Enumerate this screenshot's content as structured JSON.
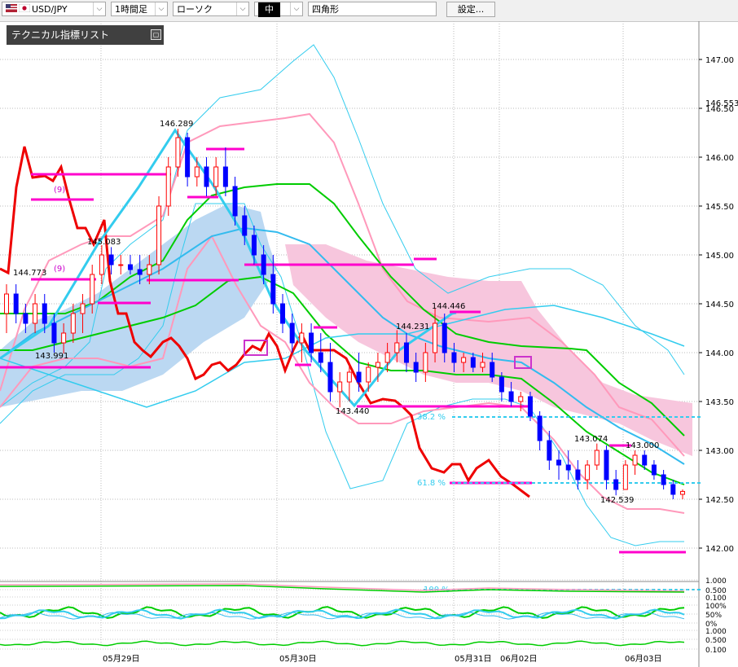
{
  "toolbar": {
    "symbol": "USD/JPY",
    "timeframe": "1時間足",
    "chart_style": "ローソク",
    "line_width": "中",
    "drawing_tool": "四角形",
    "settings_label": "設定..."
  },
  "panel": {
    "title": "テクニカル指標リスト"
  },
  "colors": {
    "up_candle": "#ff0000",
    "down_candle": "#0000ff",
    "bollinger_outer": "#33ccee",
    "bollinger_inner": "#ff99bb",
    "ma_short": "#00cc00",
    "ma_long": "#33bbee",
    "chikou": "#ee0000",
    "ichimoku_cloud_bull": "#bbd8f2",
    "ichimoku_cloud_bear": "#f7c6dd",
    "level_lines": "#ff00cc",
    "fib_lines": "#33ccee"
  },
  "chart_data": {
    "type": "candlestick",
    "y_ticks": [
      "147.00",
      "146.50",
      "146.00",
      "145.50",
      "145.00",
      "144.50",
      "144.00",
      "143.50",
      "143.00",
      "142.50",
      "142.00"
    ],
    "current_price_label": "146.553",
    "date_labels": [
      "05月29日",
      "05月30日",
      "05月31日",
      "06月02日",
      "06月03日"
    ],
    "price_annotations": [
      "146.289",
      "145.083",
      "144.773",
      "143.991",
      "144.446",
      "144.231",
      "143.440",
      "143.074",
      "143.000",
      "142.539"
    ],
    "period_labels": [
      "(9)",
      "(9)"
    ],
    "fib_labels": [
      "38.2 %",
      "61.8 %",
      "100 %"
    ],
    "oscillator_1_ticks": [
      "1.000",
      "0.500",
      "0.100"
    ],
    "oscillator_2_ticks": [
      "100%",
      "50%",
      "0%"
    ],
    "oscillator_3_ticks": [
      "1.000",
      "0.500",
      "0.100"
    ],
    "candles": [
      {
        "o": 144.4,
        "h": 144.7,
        "l": 144.2,
        "c": 144.6
      },
      {
        "o": 144.6,
        "h": 144.7,
        "l": 144.3,
        "c": 144.4
      },
      {
        "o": 144.4,
        "h": 144.5,
        "l": 144.2,
        "c": 144.3
      },
      {
        "o": 144.3,
        "h": 144.6,
        "l": 144.2,
        "c": 144.5
      },
      {
        "o": 144.5,
        "h": 144.6,
        "l": 144.2,
        "c": 144.3
      },
      {
        "o": 144.3,
        "h": 144.4,
        "l": 144.0,
        "c": 144.1
      },
      {
        "o": 144.1,
        "h": 144.3,
        "l": 143.99,
        "c": 144.2
      },
      {
        "o": 144.2,
        "h": 144.5,
        "l": 144.1,
        "c": 144.4
      },
      {
        "o": 144.4,
        "h": 144.6,
        "l": 144.2,
        "c": 144.5
      },
      {
        "o": 144.5,
        "h": 144.9,
        "l": 144.4,
        "c": 144.8
      },
      {
        "o": 144.8,
        "h": 145.1,
        "l": 144.7,
        "c": 145.0
      },
      {
        "o": 145.0,
        "h": 145.08,
        "l": 144.8,
        "c": 144.9
      },
      {
        "o": 144.9,
        "h": 145.0,
        "l": 144.8,
        "c": 144.9
      },
      {
        "o": 144.9,
        "h": 145.0,
        "l": 144.8,
        "c": 144.85
      },
      {
        "o": 144.85,
        "h": 145.0,
        "l": 144.7,
        "c": 144.8
      },
      {
        "o": 144.8,
        "h": 145.0,
        "l": 144.7,
        "c": 144.9
      },
      {
        "o": 144.9,
        "h": 145.6,
        "l": 144.8,
        "c": 145.5
      },
      {
        "o": 145.5,
        "h": 146.0,
        "l": 145.4,
        "c": 145.9
      },
      {
        "o": 145.9,
        "h": 146.29,
        "l": 145.8,
        "c": 146.2
      },
      {
        "o": 146.2,
        "h": 146.25,
        "l": 145.7,
        "c": 145.8
      },
      {
        "o": 145.8,
        "h": 146.0,
        "l": 145.7,
        "c": 145.9
      },
      {
        "o": 145.9,
        "h": 146.0,
        "l": 145.6,
        "c": 145.7
      },
      {
        "o": 145.7,
        "h": 146.0,
        "l": 145.6,
        "c": 145.9
      },
      {
        "o": 145.9,
        "h": 146.1,
        "l": 145.6,
        "c": 145.7
      },
      {
        "o": 145.7,
        "h": 145.8,
        "l": 145.3,
        "c": 145.4
      },
      {
        "o": 145.4,
        "h": 145.5,
        "l": 145.1,
        "c": 145.2
      },
      {
        "o": 145.2,
        "h": 145.3,
        "l": 144.9,
        "c": 145.0
      },
      {
        "o": 145.0,
        "h": 145.1,
        "l": 144.7,
        "c": 144.8
      },
      {
        "o": 144.8,
        "h": 145.0,
        "l": 144.4,
        "c": 144.5
      },
      {
        "o": 144.5,
        "h": 144.6,
        "l": 144.2,
        "c": 144.3
      },
      {
        "o": 144.3,
        "h": 144.4,
        "l": 144.0,
        "c": 144.1
      },
      {
        "o": 144.1,
        "h": 144.3,
        "l": 143.9,
        "c": 144.2
      },
      {
        "o": 144.2,
        "h": 144.3,
        "l": 143.9,
        "c": 144.0
      },
      {
        "o": 144.0,
        "h": 144.2,
        "l": 143.8,
        "c": 143.9
      },
      {
        "o": 143.9,
        "h": 144.1,
        "l": 143.5,
        "c": 143.6
      },
      {
        "o": 143.6,
        "h": 143.8,
        "l": 143.44,
        "c": 143.7
      },
      {
        "o": 143.7,
        "h": 143.9,
        "l": 143.5,
        "c": 143.8
      },
      {
        "o": 143.8,
        "h": 144.0,
        "l": 143.6,
        "c": 143.7
      },
      {
        "o": 143.7,
        "h": 143.9,
        "l": 143.6,
        "c": 143.85
      },
      {
        "o": 143.85,
        "h": 144.0,
        "l": 143.7,
        "c": 143.9
      },
      {
        "o": 143.9,
        "h": 144.1,
        "l": 143.8,
        "c": 144.0
      },
      {
        "o": 144.0,
        "h": 144.23,
        "l": 143.9,
        "c": 144.1
      },
      {
        "o": 144.1,
        "h": 144.2,
        "l": 143.8,
        "c": 143.9
      },
      {
        "o": 143.9,
        "h": 144.0,
        "l": 143.7,
        "c": 143.8
      },
      {
        "o": 143.8,
        "h": 144.1,
        "l": 143.7,
        "c": 144.0
      },
      {
        "o": 144.0,
        "h": 144.45,
        "l": 143.9,
        "c": 144.3
      },
      {
        "o": 144.3,
        "h": 144.4,
        "l": 143.9,
        "c": 144.0
      },
      {
        "o": 144.0,
        "h": 144.1,
        "l": 143.8,
        "c": 143.9
      },
      {
        "o": 143.9,
        "h": 144.0,
        "l": 143.8,
        "c": 143.95
      },
      {
        "o": 143.95,
        "h": 144.0,
        "l": 143.8,
        "c": 143.85
      },
      {
        "o": 143.85,
        "h": 144.0,
        "l": 143.8,
        "c": 143.9
      },
      {
        "o": 143.9,
        "h": 144.0,
        "l": 143.7,
        "c": 143.75
      },
      {
        "o": 143.75,
        "h": 143.8,
        "l": 143.5,
        "c": 143.6
      },
      {
        "o": 143.6,
        "h": 143.7,
        "l": 143.45,
        "c": 143.5
      },
      {
        "o": 143.5,
        "h": 143.6,
        "l": 143.4,
        "c": 143.55
      },
      {
        "o": 143.55,
        "h": 143.6,
        "l": 143.3,
        "c": 143.35
      },
      {
        "o": 143.35,
        "h": 143.4,
        "l": 143.0,
        "c": 143.1
      },
      {
        "o": 143.1,
        "h": 143.2,
        "l": 142.8,
        "c": 142.9
      },
      {
        "o": 142.9,
        "h": 143.0,
        "l": 142.7,
        "c": 142.85
      },
      {
        "o": 142.85,
        "h": 143.0,
        "l": 142.7,
        "c": 142.8
      },
      {
        "o": 142.8,
        "h": 142.9,
        "l": 142.6,
        "c": 142.7
      },
      {
        "o": 142.7,
        "h": 142.9,
        "l": 142.6,
        "c": 142.85
      },
      {
        "o": 142.85,
        "h": 143.07,
        "l": 142.8,
        "c": 143.0
      },
      {
        "o": 143.0,
        "h": 143.05,
        "l": 142.6,
        "c": 142.7
      },
      {
        "o": 142.7,
        "h": 142.8,
        "l": 142.54,
        "c": 142.6
      },
      {
        "o": 142.6,
        "h": 142.9,
        "l": 142.6,
        "c": 142.85
      },
      {
        "o": 142.85,
        "h": 143.0,
        "l": 142.75,
        "c": 142.95
      },
      {
        "o": 142.95,
        "h": 143.0,
        "l": 142.8,
        "c": 142.85
      },
      {
        "o": 142.85,
        "h": 142.9,
        "l": 142.7,
        "c": 142.75
      },
      {
        "o": 142.75,
        "h": 142.8,
        "l": 142.6,
        "c": 142.65
      },
      {
        "o": 142.65,
        "h": 142.7,
        "l": 142.5,
        "c": 142.55
      },
      {
        "o": 142.55,
        "h": 142.6,
        "l": 142.5,
        "c": 142.58
      }
    ]
  }
}
